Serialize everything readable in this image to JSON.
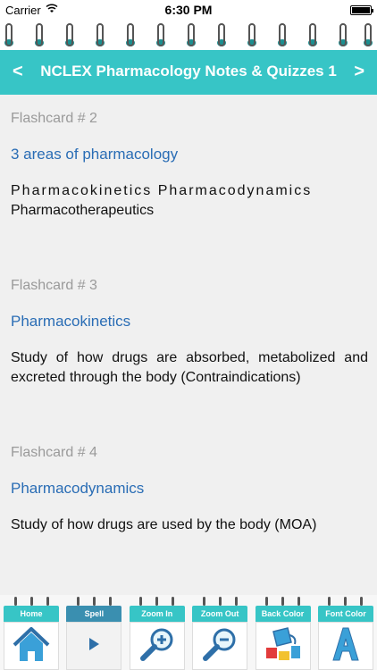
{
  "status_bar": {
    "carrier": "Carrier",
    "time": "6:30 PM",
    "battery_level": 1.0
  },
  "header": {
    "title": "NCLEX Pharmacology Notes & Quizzes 1",
    "prev_label": "<",
    "next_label": ">",
    "accent_color": "#37c5c6"
  },
  "cards": [
    {
      "number": "Flashcard # 2",
      "question": "3 areas of pharmacology",
      "answer_line1": "Pharmacokinetics Pharmacodynamics",
      "answer_line2": "Pharmacotherapeutics"
    },
    {
      "number": "Flashcard # 3",
      "question": "Pharmacokinetics",
      "answer": "Study of how drugs are absorbed, metabolized and excreted through the body (Contraindications)"
    },
    {
      "number": "Flashcard # 4",
      "question": "Pharmacodynamics",
      "answer": "Study of how drugs are used by the body (MOA)"
    }
  ],
  "toolbar": {
    "home_label": "Home",
    "spell_label": "Spell",
    "zoom_in_label": "Zoom In",
    "zoom_out_label": "Zoom Out",
    "back_color_label": "Back Color",
    "font_color_label": "Font Color"
  },
  "icons": [
    "wifi-icon",
    "battery-icon",
    "home-icon",
    "play-icon",
    "zoom-in-icon",
    "zoom-out-icon",
    "paint-bucket-icon",
    "font-color-icon"
  ]
}
